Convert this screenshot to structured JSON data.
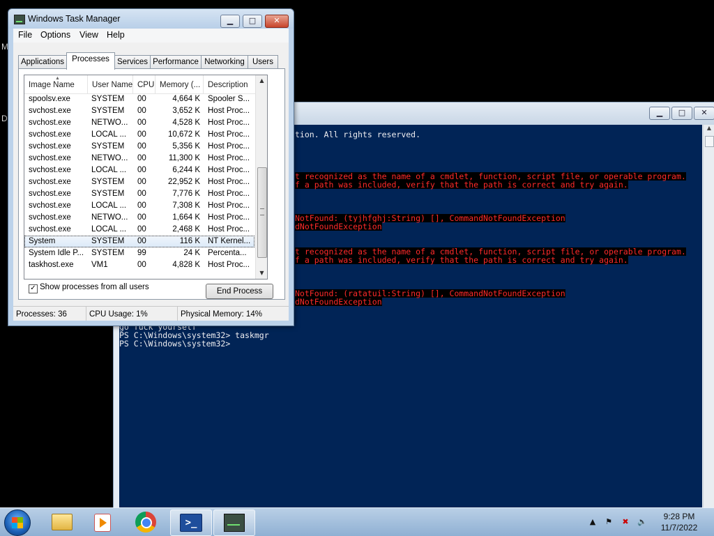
{
  "desktop": {
    "fragments": [
      "M",
      "D"
    ]
  },
  "powershell": {
    "lines": [
      {
        "text": "tion. All rights reserved.",
        "error": false
      },
      {
        "text": "t recognized as the name of a cmdlet, function, script file, or operable program.",
        "error": true
      },
      {
        "text": "f a path was included, verify that the path is correct and try again.",
        "error": true
      },
      {
        "text": "NotFound: (tyjhfghj:String) [], CommandNotFoundException",
        "error": true
      },
      {
        "text": "dNotFoundException",
        "error": true
      },
      {
        "text": "t recognized as the name of a cmdlet, function, script file, or operable program.",
        "error": true
      },
      {
        "text": "f a path was included, verify that the path is correct and try again.",
        "error": true
      },
      {
        "text": "NotFound: (ratatuil:String) [], CommandNotFoundException",
        "error": true
      },
      {
        "text": "dNotFoundException",
        "error": true
      },
      {
        "text": "go fuck yourself",
        "error": false
      },
      {
        "text": "PS C:\\Windows\\system32> taskmgr",
        "error": false
      },
      {
        "text": "PS C:\\Windows\\system32>",
        "error": false
      }
    ]
  },
  "taskmgr": {
    "title": "Windows Task Manager",
    "menu": [
      "File",
      "Options",
      "View",
      "Help"
    ],
    "tabs": [
      "Applications",
      "Processes",
      "Services",
      "Performance",
      "Networking",
      "Users"
    ],
    "active_tab": "Processes",
    "columns": [
      "Image Name",
      "User Name",
      "CPU",
      "Memory (...",
      "Description"
    ],
    "rows": [
      [
        "spoolsv.exe",
        "SYSTEM",
        "00",
        "4,664 K",
        "Spooler S..."
      ],
      [
        "svchost.exe",
        "SYSTEM",
        "00",
        "3,652 K",
        "Host Proc..."
      ],
      [
        "svchost.exe",
        "NETWO...",
        "00",
        "4,528 K",
        "Host Proc..."
      ],
      [
        "svchost.exe",
        "LOCAL ...",
        "00",
        "10,672 K",
        "Host Proc..."
      ],
      [
        "svchost.exe",
        "SYSTEM",
        "00",
        "5,356 K",
        "Host Proc..."
      ],
      [
        "svchost.exe",
        "NETWO...",
        "00",
        "11,300 K",
        "Host Proc..."
      ],
      [
        "svchost.exe",
        "LOCAL ...",
        "00",
        "6,244 K",
        "Host Proc..."
      ],
      [
        "svchost.exe",
        "SYSTEM",
        "00",
        "22,952 K",
        "Host Proc..."
      ],
      [
        "svchost.exe",
        "SYSTEM",
        "00",
        "7,776 K",
        "Host Proc..."
      ],
      [
        "svchost.exe",
        "LOCAL ...",
        "00",
        "7,308 K",
        "Host Proc..."
      ],
      [
        "svchost.exe",
        "NETWO...",
        "00",
        "1,664 K",
        "Host Proc..."
      ],
      [
        "svchost.exe",
        "LOCAL ...",
        "00",
        "2,468 K",
        "Host Proc..."
      ],
      [
        "System",
        "SYSTEM",
        "00",
        "116 K",
        "NT Kernel..."
      ],
      [
        "System Idle P...",
        "SYSTEM",
        "99",
        "24 K",
        "Percenta..."
      ],
      [
        "taskhost.exe",
        "VM1",
        "00",
        "4,828 K",
        "Host Proc..."
      ]
    ],
    "selected_row": 12,
    "show_all_label": "Show processes from all users",
    "show_all_checked": "✓",
    "end_process_label": "End Process",
    "status": {
      "processes": "Processes: 36",
      "cpu": "CPU Usage: 1%",
      "memory": "Physical Memory: 14%"
    }
  },
  "taskbar": {
    "clock_time": "9:28 PM",
    "clock_date": "11/7/2022",
    "ps_glyph": ">_"
  }
}
